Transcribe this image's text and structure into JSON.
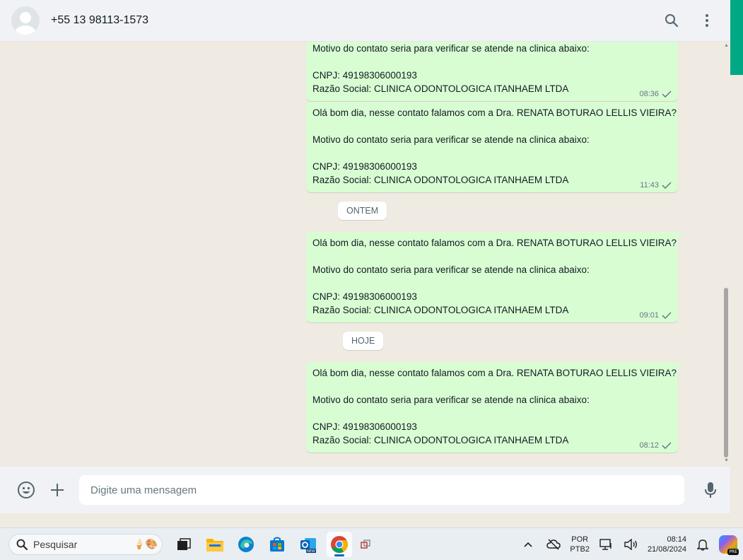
{
  "header": {
    "contact_name": "+55 13 98113-1573"
  },
  "messages": [
    {
      "lines": [
        "Motivo do contato seria para verificar se atende na clinica abaixo:",
        "",
        "CNPJ: 49198306000193",
        "Razão Social: CLINICA ODONTOLOGICA ITANHAEM LTDA"
      ],
      "time": "08:36"
    },
    {
      "lines": [
        "Olá bom dia, nesse contato falamos com a Dra. RENATA BOTURAO LELLIS VIEIRA?",
        "",
        "Motivo do contato seria para verificar se atende na clinica abaixo:",
        "",
        "CNPJ: 49198306000193",
        "Razão Social: CLINICA ODONTOLOGICA ITANHAEM LTDA"
      ],
      "time": "11:43"
    },
    {
      "lines": [
        "Olá bom dia, nesse contato falamos com a Dra. RENATA BOTURAO LELLIS VIEIRA?",
        "",
        "Motivo do contato seria para verificar se atende na clinica abaixo:",
        "",
        "CNPJ: 49198306000193",
        "Razão Social: CLINICA ODONTOLOGICA ITANHAEM LTDA"
      ],
      "time": "09:01"
    },
    {
      "lines": [
        "Olá bom dia, nesse contato falamos com a Dra. RENATA BOTURAO LELLIS VIEIRA?",
        "",
        "Motivo do contato seria para verificar se atende na clinica abaixo:",
        "",
        "CNPJ: 49198306000193",
        "Razão Social: CLINICA ODONTOLOGICA ITANHAEM LTDA"
      ],
      "time": "08:12"
    }
  ],
  "date_chips": {
    "yesterday": "ONTEM",
    "today": "HOJE"
  },
  "composer": {
    "placeholder": "Digite uma mensagem"
  },
  "taskbar": {
    "search_label": "Pesquisar",
    "language": "POR",
    "keyboard": "PTB2",
    "time": "08:14",
    "date": "21/08/2024",
    "copilot_badge": "PRE"
  },
  "colors": {
    "outgoing_bubble": "#d9fdd3",
    "accent": "#00a884",
    "chat_background": "#efeae2"
  }
}
